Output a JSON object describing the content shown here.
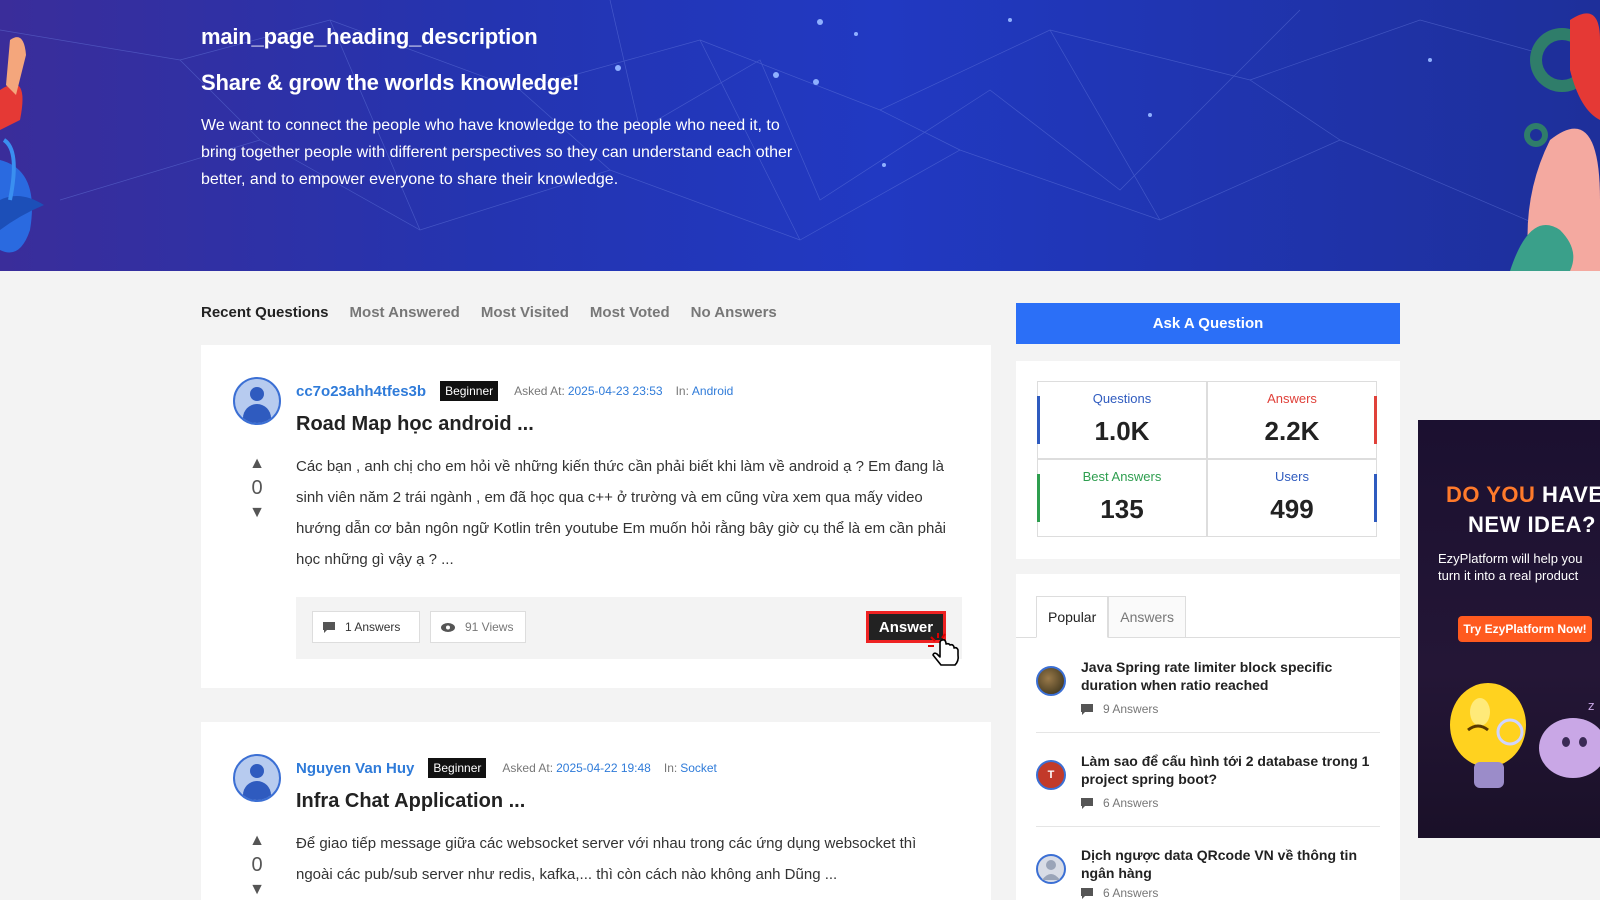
{
  "hero": {
    "title": "main_page_heading_description",
    "subtitle": "Share & grow the worlds knowledge!",
    "description": "We want to connect the people who have knowledge to the people who need it, to bring together people with different perspectives so they can understand each other better, and to empower everyone to share their knowledge."
  },
  "tabs": [
    {
      "label": "Recent Questions",
      "active": true
    },
    {
      "label": "Most Answered"
    },
    {
      "label": "Most Visited"
    },
    {
      "label": "Most Voted"
    },
    {
      "label": "No Answers"
    }
  ],
  "questions": [
    {
      "author": "cc7o23ahh4tfes3b",
      "badge": "Beginner",
      "asked_label": "Asked At:",
      "asked_at": "2025-04-23 23:53",
      "in_label": "In:",
      "category": "Android",
      "title": "Road Map học android ...",
      "votes": "0",
      "excerpt": "Các bạn , anh chị cho em hỏi về những kiến thức cần phải biết khi làm về android ạ ? Em đang là sinh viên năm 2 trái ngành , em đã học qua c++ ở trường và em cũng vừa xem qua mấy video hướng dẫn cơ bản ngôn ngữ Kotlin trên youtube Em muốn hỏi rằng bây giờ cụ thể là em cần phải học những gì vậy ạ ? ...",
      "answers": "1 Answers",
      "views": "91 Views",
      "answer_button": "Answer"
    },
    {
      "author": "Nguyen Van Huy",
      "badge": "Beginner",
      "asked_label": "Asked At:",
      "asked_at": "2025-04-22 19:48",
      "in_label": "In:",
      "category": "Socket",
      "title": "Infra Chat Application ...",
      "votes": "0",
      "excerpt": "Để giao tiếp message giữa các websocket server với nhau trong các ứng dụng websocket thì ngoài các pub/sub server như redis, kafka,... thì còn cách nào không anh Dũng ..."
    }
  ],
  "sidebar": {
    "ask_button": "Ask A Question",
    "stats": [
      {
        "label": "Questions",
        "value": "1.0K",
        "color": "#2f5bbf"
      },
      {
        "label": "Answers",
        "value": "2.2K",
        "color": "#e0413a"
      },
      {
        "label": "Best Answers",
        "value": "135",
        "color": "#2e9e4f"
      },
      {
        "label": "Users",
        "value": "499",
        "color": "#2f5bbf"
      }
    ],
    "popular_tabs": [
      {
        "label": "Popular",
        "active": true
      },
      {
        "label": "Answers"
      }
    ],
    "popular_items": [
      {
        "title": "Java Spring rate limiter block specific duration when ratio reached",
        "count": "9 Answers"
      },
      {
        "title": "Làm sao để cấu hình tới 2 database trong 1 project spring boot?",
        "count": "6 Answers",
        "avatar_letter": "T"
      },
      {
        "title": "Dịch ngược data QRcode VN về thông tin ngân hàng",
        "count": "6 Answers"
      }
    ]
  },
  "ad": {
    "headline_highlight": "DO YOU",
    "headline_rest": " HAVE A",
    "headline_line2": "NEW IDEA?",
    "sub_line1": "EzyPlatform will help you",
    "sub_line2": "turn it into a real product",
    "cta": "Try EzyPlatform Now!"
  }
}
